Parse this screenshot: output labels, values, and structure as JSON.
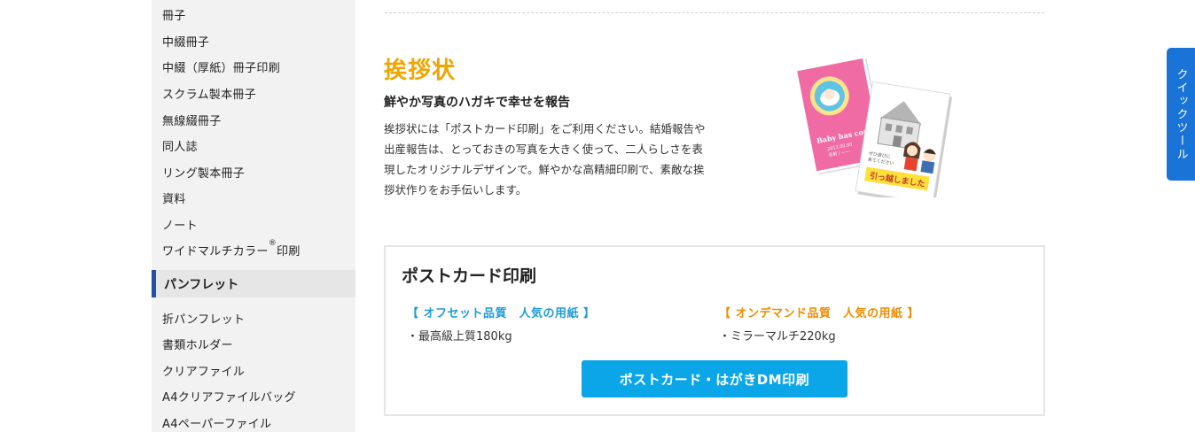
{
  "sidebar": {
    "items_top": [
      {
        "label": "冊子"
      },
      {
        "label": "中綴冊子"
      },
      {
        "label": "中綴（厚紙）冊子印刷"
      },
      {
        "label": "スクラム製本冊子"
      },
      {
        "label": "無線綴冊子"
      },
      {
        "label": "同人誌"
      },
      {
        "label": "リング製本冊子"
      },
      {
        "label": "資料"
      },
      {
        "label": "ノート"
      },
      {
        "label": "ワイドマルチカラー",
        "mark": "®",
        "suffix": "印刷"
      }
    ],
    "section": {
      "label": "パンフレット",
      "accent": "#1f4fa8"
    },
    "items_bottom": [
      {
        "label": "折パンフレット"
      },
      {
        "label": "書類ホルダー"
      },
      {
        "label": "クリアファイル"
      },
      {
        "label": "A4クリアファイルバッグ"
      },
      {
        "label": "A4ペーパーファイル"
      }
    ]
  },
  "main": {
    "title": "挨拶状",
    "subtitle": "鮮やか写真のハガキで幸せを報告",
    "description": "挨拶状には「ポストカード印刷」をご利用ください。結婚報告や出産報告は、とっておきの写真を大きく使って、二人らしさを表現したオリジナルデザインで。鮮やかな高精細印刷で、素敵な挨拶状作りをお手伝いします。",
    "title_color": "#f0a500",
    "illustration": {
      "card1_text": "Baby has com",
      "card1_sub": "2013.00.00",
      "card1_sub2": "名前 / ——",
      "card2_small1": "ぜひ遊びに",
      "card2_small2": "来てください",
      "card2_banner": "引っ越しました"
    }
  },
  "postcard_box": {
    "title": "ポストカード印刷",
    "offset": {
      "heading": "【 オフセット品質　人気の用紙 】",
      "item": "・最高級上質180kg",
      "color": "#1e9bd7"
    },
    "ondemand": {
      "heading": "【 オンデマンド品質　人気の用紙 】",
      "item": "・ミラーマルチ220kg",
      "color": "#f08c00"
    },
    "button_label": "ポストカード・はがきDM印刷",
    "button_color": "#0aa6e8"
  },
  "quick_tool": {
    "label": "クイックツール",
    "color": "#1a73d6"
  }
}
